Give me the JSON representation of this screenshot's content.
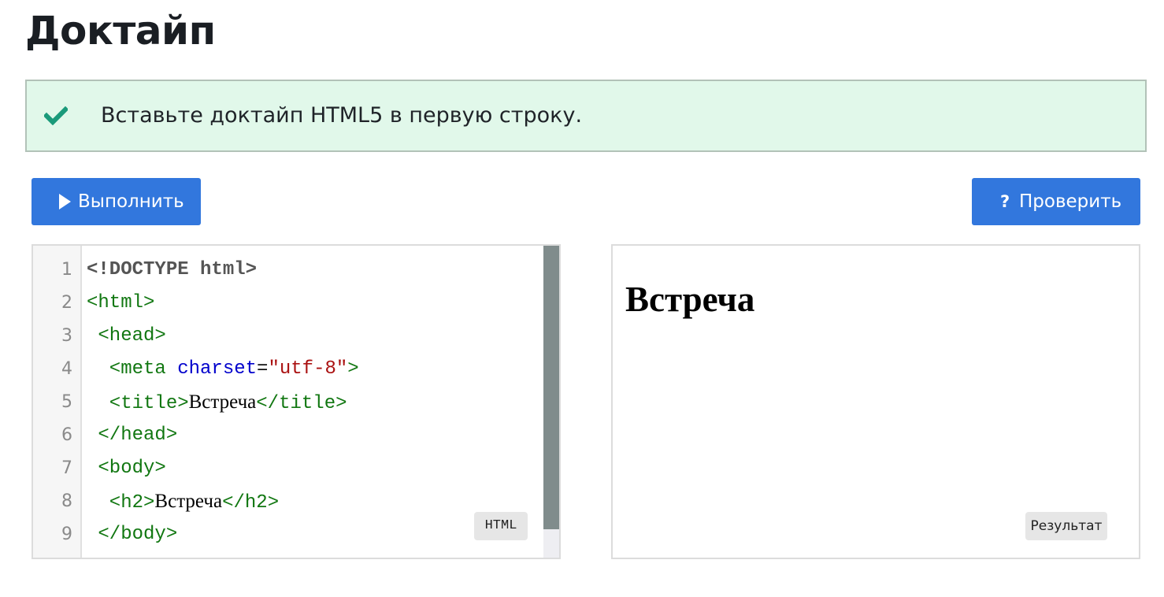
{
  "page": {
    "title": "Доктайп"
  },
  "task": {
    "status_icon": "check-icon",
    "message": "Вставьте доктайп HTML5 в первую строку."
  },
  "toolbar": {
    "run_icon": "play-icon",
    "run_label": "Выполнить",
    "check_icon": "question-icon",
    "check_glyph": "?",
    "check_label": "Проверить"
  },
  "editor": {
    "language_badge": "HTML",
    "lines": [
      {
        "n": "1",
        "parts": [
          [
            "doctype",
            "<!DOCTYPE html>"
          ]
        ]
      },
      {
        "n": "2",
        "parts": [
          [
            "tag",
            "<html>"
          ]
        ]
      },
      {
        "n": "3",
        "parts": [
          [
            "tag",
            " <head>"
          ]
        ]
      },
      {
        "n": "4",
        "parts": [
          [
            "tag",
            "  <meta "
          ],
          [
            "attr",
            "charset"
          ],
          [
            "eq",
            "="
          ],
          [
            "str",
            "\"utf-8\""
          ],
          [
            "tag",
            ">"
          ]
        ]
      },
      {
        "n": "5",
        "parts": [
          [
            "tag",
            "  <title>"
          ],
          [
            "text",
            "Встреча"
          ],
          [
            "tag",
            "</title>"
          ]
        ]
      },
      {
        "n": "6",
        "parts": [
          [
            "tag",
            " </head>"
          ]
        ]
      },
      {
        "n": "7",
        "parts": [
          [
            "tag",
            " <body>"
          ]
        ]
      },
      {
        "n": "8",
        "parts": [
          [
            "tag",
            "  <h2>"
          ],
          [
            "text",
            "Встреча"
          ],
          [
            "tag",
            "</h2>"
          ]
        ]
      },
      {
        "n": "9",
        "parts": [
          [
            "tag",
            " </body>"
          ]
        ]
      }
    ]
  },
  "result": {
    "heading": "Встреча",
    "badge": "Результат"
  },
  "colors": {
    "button": "#3277dd",
    "success_bg": "#e1f8ea",
    "check": "#1a9a7a",
    "tag": "#117711",
    "attr": "#0000cc",
    "string": "#aa1111"
  }
}
